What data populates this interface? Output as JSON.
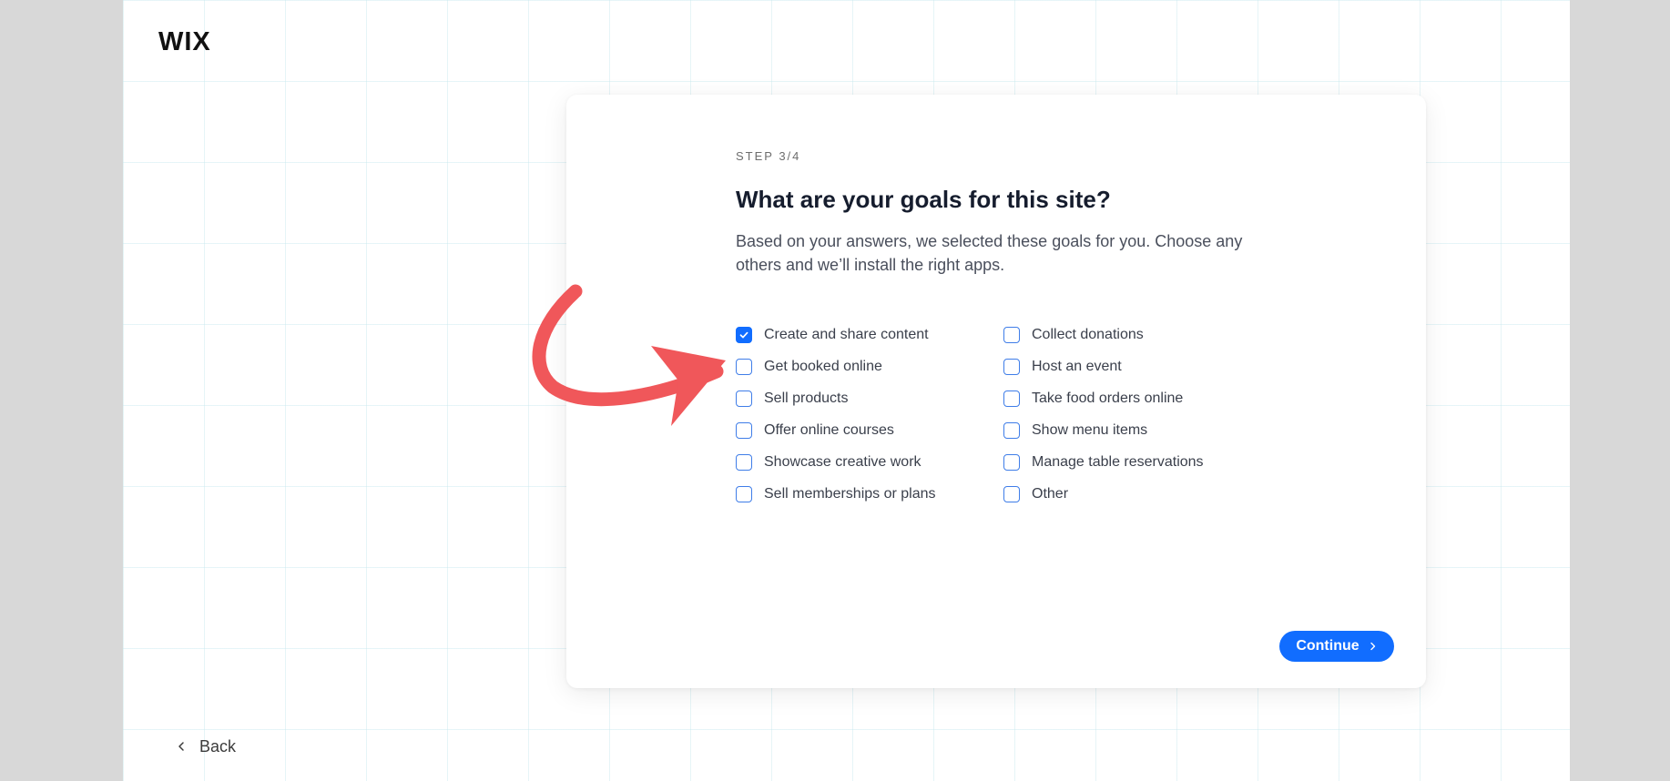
{
  "brand": {
    "logo_text": "WIX"
  },
  "nav": {
    "back_label": "Back"
  },
  "wizard": {
    "step_label": "STEP 3/4",
    "title": "What are your goals for this site?",
    "subtitle": "Based on your answers, we selected these goals for you. Choose any others and we’ll install the right apps.",
    "goals_left": [
      {
        "label": "Create and share content",
        "checked": true
      },
      {
        "label": "Get booked online",
        "checked": false
      },
      {
        "label": "Sell products",
        "checked": false
      },
      {
        "label": "Offer online courses",
        "checked": false
      },
      {
        "label": "Showcase creative work",
        "checked": false
      },
      {
        "label": "Sell memberships or plans",
        "checked": false
      }
    ],
    "goals_right": [
      {
        "label": "Collect donations",
        "checked": false
      },
      {
        "label": "Host an event",
        "checked": false
      },
      {
        "label": "Take food orders online",
        "checked": false
      },
      {
        "label": "Show menu items",
        "checked": false
      },
      {
        "label": "Manage table reservations",
        "checked": false
      },
      {
        "label": "Other",
        "checked": false
      }
    ],
    "continue_label": "Continue"
  },
  "colors": {
    "accent": "#116dff",
    "annotation_arrow": "#f0575a"
  }
}
